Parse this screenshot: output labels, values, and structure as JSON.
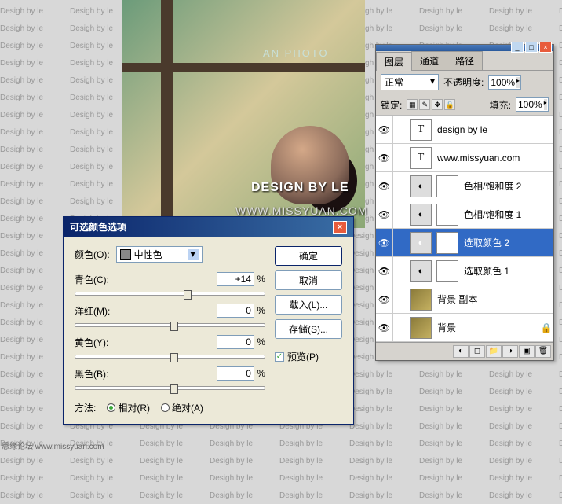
{
  "background": {
    "text": "Desigh by le"
  },
  "photo": {
    "anphoto": "AN PHOTO"
  },
  "watermark": {
    "line1": "DESIGN BY LE",
    "line2": "WWW.MISSYUAN.COM"
  },
  "dialog": {
    "title": "可选颜色选项",
    "color_label": "颜色(O):",
    "color_value": "中性色",
    "sliders": [
      {
        "label": "青色(C):",
        "value": "+14",
        "pct": 57
      },
      {
        "label": "洋红(M):",
        "value": "0",
        "pct": 50
      },
      {
        "label": "黄色(Y):",
        "value": "0",
        "pct": 50
      },
      {
        "label": "黑色(B):",
        "value": "0",
        "pct": 50
      }
    ],
    "percent": "%",
    "method_label": "方法:",
    "method_rel": "相对(R)",
    "method_abs": "绝对(A)",
    "ok": "确定",
    "cancel": "取消",
    "load": "载入(L)...",
    "save": "存储(S)...",
    "preview": "预览(P)"
  },
  "layers": {
    "tabs": [
      "图层",
      "通道",
      "路径"
    ],
    "blend": "正常",
    "opacity_label": "不透明度:",
    "opacity": "100%",
    "lock_label": "锁定:",
    "fill_label": "填充:",
    "fill": "100%",
    "items": [
      {
        "type": "T",
        "name": "design by le"
      },
      {
        "type": "T",
        "name": "www.missyuan.com"
      },
      {
        "type": "adj",
        "name": "色相/饱和度 2"
      },
      {
        "type": "adj",
        "name": "色相/饱和度 1"
      },
      {
        "type": "adj",
        "name": "选取颜色 2",
        "selected": true
      },
      {
        "type": "adj",
        "name": "选取颜色 1"
      },
      {
        "type": "img",
        "name": "背景 副本"
      },
      {
        "type": "img",
        "name": "背景",
        "locked": true
      }
    ]
  },
  "footer": "思缘论坛   www.missyuan.com"
}
